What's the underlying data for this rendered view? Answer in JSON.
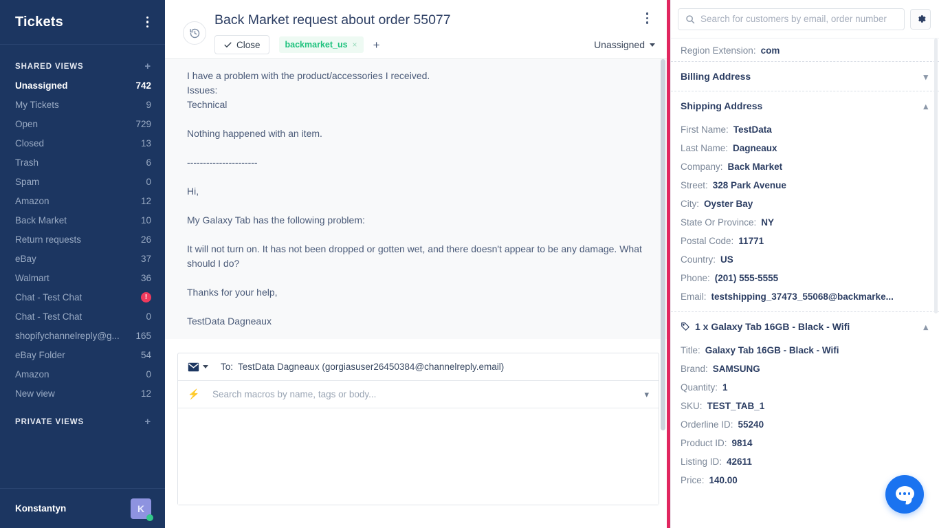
{
  "sidebar": {
    "title": "Tickets",
    "shared_views_label": "SHARED VIEWS",
    "private_views_label": "PRIVATE VIEWS",
    "add_label": "+",
    "items": [
      {
        "label": "Unassigned",
        "count": "742",
        "active": true
      },
      {
        "label": "My Tickets",
        "count": "9"
      },
      {
        "label": "Open",
        "count": "729"
      },
      {
        "label": "Closed",
        "count": "13"
      },
      {
        "label": "Trash",
        "count": "6"
      },
      {
        "label": "Spam",
        "count": "0"
      },
      {
        "label": "Amazon",
        "count": "12"
      },
      {
        "label": "Back Market",
        "count": "10"
      },
      {
        "label": "Return requests",
        "count": "26"
      },
      {
        "label": "eBay",
        "count": "37"
      },
      {
        "label": "Walmart",
        "count": "36"
      },
      {
        "label": "Chat - Test Chat",
        "count": "!",
        "alert": true
      },
      {
        "label": "Chat - Test Chat",
        "count": "0"
      },
      {
        "label": "shopifychannelreply@g...",
        "count": "165"
      },
      {
        "label": "eBay Folder",
        "count": "54"
      },
      {
        "label": "Amazon",
        "count": "0"
      },
      {
        "label": "New view",
        "count": "12"
      }
    ],
    "user": {
      "name": "Konstantyn",
      "initial": "K"
    }
  },
  "ticket": {
    "title": "Back Market request about order 55077",
    "close_label": "Close",
    "tag": "backmarket_us",
    "tag_remove": "×",
    "tag_add": "+",
    "assignee": "Unassigned",
    "message_body": "I have a problem with the product/accessories I received.\nIssues:\nTechnical\n\nNothing happened with an item.\n\n----------------------\n\nHi,\n\nMy Galaxy Tab has the following problem:\n\nIt will not turn on. It has not been dropped or gotten wet, and there doesn't appear to be any damage. What should I do?\n\nThanks for your help,\n\nTestData Dagneaux"
  },
  "composer": {
    "to_label": "To:",
    "to_value": "TestData Dagneaux (gorgiasuser26450384@channelreply.email)",
    "macro_placeholder": "Search macros by name, tags or body..."
  },
  "right_panel": {
    "search_placeholder": "Search for customers by email, order number",
    "region_extension_label": "Region Extension:",
    "region_extension_value": "com",
    "billing_address_label": "Billing Address",
    "shipping_address_label": "Shipping Address",
    "shipping": [
      {
        "key": "First Name:",
        "value": "TestData"
      },
      {
        "key": "Last Name:",
        "value": "Dagneaux"
      },
      {
        "key": "Company:",
        "value": "Back Market"
      },
      {
        "key": "Street:",
        "value": "328 Park Avenue"
      },
      {
        "key": "City:",
        "value": "Oyster Bay"
      },
      {
        "key": "State Or Province:",
        "value": "NY"
      },
      {
        "key": "Postal Code:",
        "value": "11771"
      },
      {
        "key": "Country:",
        "value": "US"
      },
      {
        "key": "Phone:",
        "value": "(201) 555-5555"
      },
      {
        "key": "Email:",
        "value": "testshipping_37473_55068@backmarke..."
      }
    ],
    "line_item_title": "1 x Galaxy Tab 16GB - Black - Wifi",
    "line_item": [
      {
        "key": "Title:",
        "value": "Galaxy Tab 16GB - Black - Wifi"
      },
      {
        "key": "Brand:",
        "value": "SAMSUNG"
      },
      {
        "key": "Quantity:",
        "value": "1"
      },
      {
        "key": "SKU:",
        "value": "TEST_TAB_1"
      },
      {
        "key": "Orderline ID:",
        "value": "55240"
      },
      {
        "key": "Product ID:",
        "value": "9814"
      },
      {
        "key": "Listing ID:",
        "value": "42611"
      },
      {
        "key": "Price:",
        "value": "140.00"
      }
    ]
  },
  "colors": {
    "sidebar_bg": "#1c3661",
    "accent_rail": "#e1265f",
    "tag_green": "#1ec27d",
    "alert_red": "#ef3a5d",
    "fab_blue": "#1a73f0",
    "presence_green": "#33c98a"
  }
}
